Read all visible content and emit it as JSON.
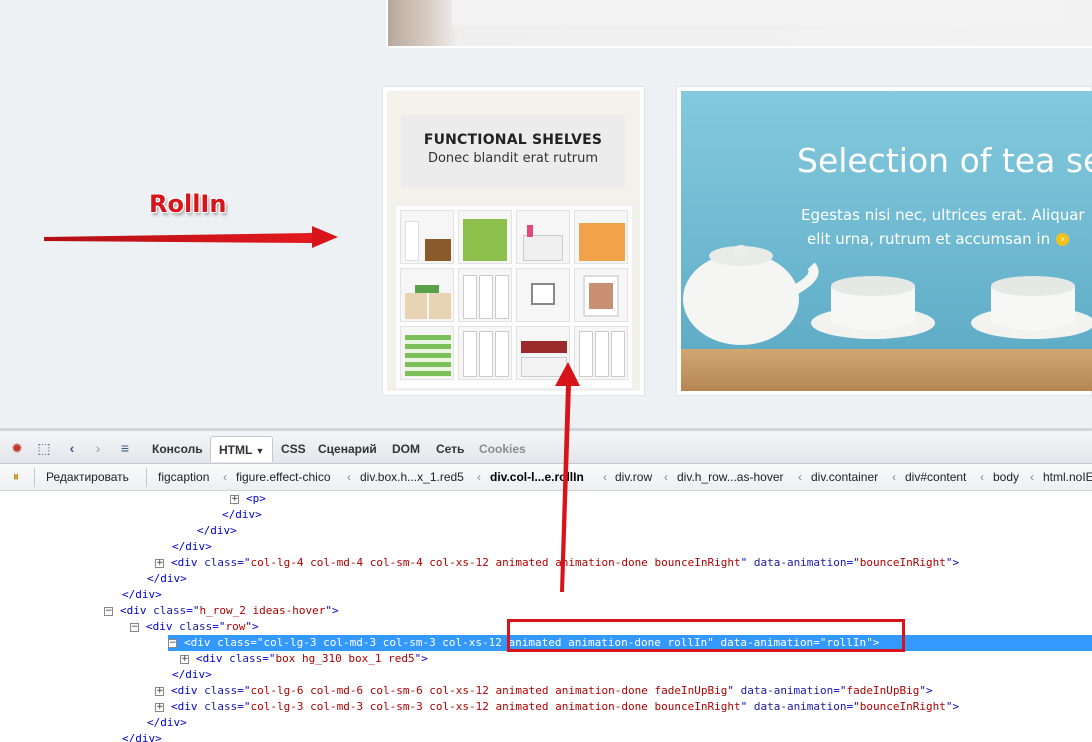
{
  "site": {
    "annotation_label": "RollIn",
    "shelf_card": {
      "title": "FUNCTIONAL SHELVES",
      "subtitle": "Donec blandit erat rutrum"
    },
    "tea_card": {
      "title": "Selection of tea set",
      "text_line1": "Egestas nisi nec, ultrices erat. Aliquar",
      "text_line2": "elit urna, rutrum et accumsan in",
      "more_icon": "arrow-circle-right-icon",
      "icon_color": "#f2c21c"
    }
  },
  "devtools": {
    "tabs": [
      "Консоль",
      "HTML",
      "CSS",
      "Сценарий",
      "DOM",
      "Сеть",
      "Cookies"
    ],
    "active_tab": "HTML",
    "edit_label": "Редактировать",
    "breadcrumbs": [
      "figcaption",
      "figure.effect-chico",
      "div.box.h...x_1.red5",
      "div.col-l...e.rollIn",
      "div.row",
      "div.h_row...as-hover",
      "div.container",
      "div#content",
      "body",
      "html.noIE"
    ],
    "selected_crumb": "div.col-l...e.rollIn",
    "tree_lines": [
      {
        "id": "l0",
        "parts": [
          [
            "tag",
            "<p>"
          ]
        ],
        "expander": "+"
      },
      {
        "id": "l1",
        "parts": [
          [
            "tag",
            "</div>"
          ]
        ]
      },
      {
        "id": "l2",
        "parts": [
          [
            "tag",
            "</div>"
          ]
        ]
      },
      {
        "id": "l3",
        "parts": [
          [
            "tag",
            "</div>"
          ]
        ]
      },
      {
        "id": "l4",
        "expander": "+",
        "parts": [
          [
            "tag",
            "<div "
          ],
          [
            "attr",
            "class"
          ],
          [
            "tag",
            "=\""
          ],
          [
            "val",
            "col-lg-4 col-md-4 col-sm-4 col-xs-12 animated animation-done bounceInRight"
          ],
          [
            "tag",
            "\" "
          ],
          [
            "attr",
            "data-animation"
          ],
          [
            "tag",
            "=\""
          ],
          [
            "val",
            "bounceInRight"
          ],
          [
            "tag",
            "\">"
          ]
        ]
      },
      {
        "id": "l5",
        "parts": [
          [
            "tag",
            "</div>"
          ]
        ]
      },
      {
        "id": "l6",
        "parts": [
          [
            "tag",
            "</div>"
          ]
        ]
      },
      {
        "id": "l7",
        "expander": "−",
        "parts": [
          [
            "tag",
            "<div "
          ],
          [
            "attr",
            "class"
          ],
          [
            "tag",
            "=\""
          ],
          [
            "val",
            "h_row_2 ideas-hover"
          ],
          [
            "tag",
            "\">"
          ]
        ]
      },
      {
        "id": "l8",
        "expander": "−",
        "parts": [
          [
            "tag",
            "<div "
          ],
          [
            "attr",
            "class"
          ],
          [
            "tag",
            "=\""
          ],
          [
            "val",
            "row"
          ],
          [
            "tag",
            "\">"
          ]
        ]
      },
      {
        "id": "l9",
        "expander": "−",
        "selected": true,
        "parts": [
          [
            "tag",
            "<div "
          ],
          [
            "attr",
            "class"
          ],
          [
            "tag",
            "=\""
          ],
          [
            "val",
            "col-lg-3 col-md-3 col-sm-3 col-xs-12 animated animation-done rollIn"
          ],
          [
            "tag",
            "\" "
          ],
          [
            "attr",
            "data-animation"
          ],
          [
            "tag",
            "=\""
          ],
          [
            "val",
            "rollIn"
          ],
          [
            "tag",
            "\">"
          ]
        ]
      },
      {
        "id": "l10",
        "expander": "+",
        "parts": [
          [
            "tag",
            "<div "
          ],
          [
            "attr",
            "class"
          ],
          [
            "tag",
            "=\""
          ],
          [
            "val",
            "box hg_310 box_1 red5"
          ],
          [
            "tag",
            "\">"
          ]
        ]
      },
      {
        "id": "l11",
        "parts": [
          [
            "tag",
            "</div>"
          ]
        ]
      },
      {
        "id": "l12",
        "expander": "+",
        "parts": [
          [
            "tag",
            "<div "
          ],
          [
            "attr",
            "class"
          ],
          [
            "tag",
            "=\""
          ],
          [
            "val",
            "col-lg-6 col-md-6 col-sm-6 col-xs-12 animated animation-done fadeInUpBig"
          ],
          [
            "tag",
            "\" "
          ],
          [
            "attr",
            "data-animation"
          ],
          [
            "tag",
            "=\""
          ],
          [
            "val",
            "fadeInUpBig"
          ],
          [
            "tag",
            "\">"
          ]
        ]
      },
      {
        "id": "l13",
        "expander": "+",
        "parts": [
          [
            "tag",
            "<div "
          ],
          [
            "attr",
            "class"
          ],
          [
            "tag",
            "=\""
          ],
          [
            "val",
            "col-lg-3 col-md-3 col-sm-3 col-xs-12 animated animation-done bounceInRight"
          ],
          [
            "tag",
            "\" "
          ],
          [
            "attr",
            "data-animation"
          ],
          [
            "tag",
            "=\""
          ],
          [
            "val",
            "bounceInRight"
          ],
          [
            "tag",
            "\">"
          ]
        ]
      },
      {
        "id": "l14",
        "parts": [
          [
            "tag",
            "</div>"
          ]
        ]
      },
      {
        "id": "l15",
        "parts": [
          [
            "tag",
            "</div>"
          ]
        ]
      }
    ]
  },
  "colors": {
    "annotation_red": "#d8141b",
    "selection_blue": "#3399ff"
  }
}
